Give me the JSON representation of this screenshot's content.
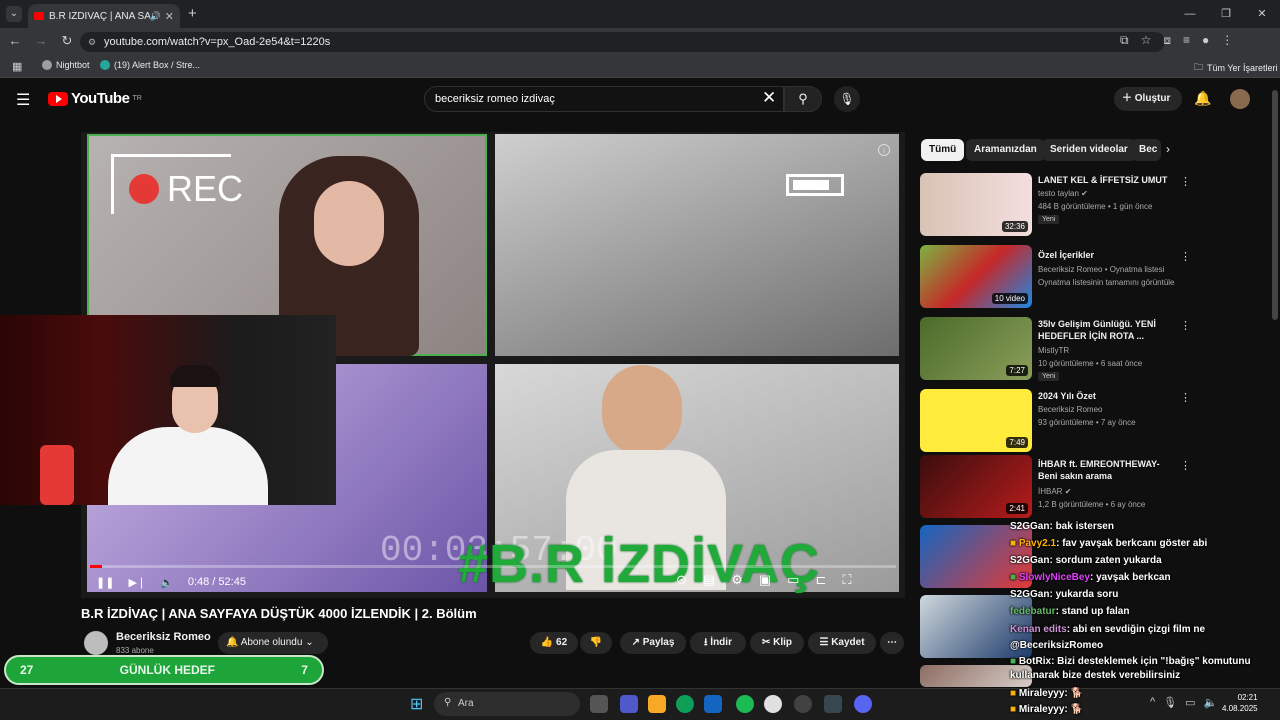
{
  "browser": {
    "tab_title": "B.R İZDİVAÇ | ANA SAYFAYA",
    "url": "youtube.com/watch?v=px_Oad-2e54&t=1220s",
    "bookmarks": [
      "Nightbot",
      "(19) Alert Box / Stre...",
      "Tüm Yer İşaretleri"
    ]
  },
  "masthead": {
    "logo_text": "YouTube",
    "region": "TR",
    "search_query": "beceriksiz romeo izdivaç",
    "create_label": "Oluştur"
  },
  "player": {
    "rec_label": "REC",
    "overlay_timer": "00:03:57:00",
    "overlay_title": "#B.R İZDİVAÇ",
    "time": "0:48 / 52:45",
    "progress": 0.015
  },
  "video": {
    "title": "B.R İZDİVAÇ | ANA SAYFAYA DÜŞTÜK 4000 İZLENDİK | 2. Bölüm",
    "channel": "Beceriksiz Romeo",
    "subscribers": "833 abone",
    "subscribe_label": "Abone olundu",
    "likes": "62",
    "share_label": "Paylaş",
    "download_label": "İndir",
    "clip_label": "Klip",
    "save_label": "Kaydet"
  },
  "chips": [
    "Tümü",
    "Aramanızdan",
    "Seriden videolar",
    "Bec"
  ],
  "recommendations": [
    {
      "title": "LANET KEL & İFFETSİZ UMUT",
      "channel": "testo taylan",
      "meta": "484 B görüntüleme • 1 gün önce",
      "badge": "Yeni",
      "duration": "32:36"
    },
    {
      "title": "Özel İçerikler",
      "channel": "Beceriksiz Romeo • Oynatma listesi",
      "meta": "Oynatma listesinin tamamını görüntüle",
      "badge": "",
      "duration": "10 video"
    },
    {
      "title": "35lv Gelişim Günlüğü. YENİ HEDEFLER İÇİN ROTA ...",
      "channel": "MistlyTR",
      "meta": "10 görüntüleme • 6 saat önce",
      "badge": "Yeni",
      "duration": "7:27"
    },
    {
      "title": "2024 Yılı Özet",
      "channel": "Beceriksiz Romeo",
      "meta": "93 görüntüleme • 7 ay önce",
      "badge": "",
      "duration": "7:49"
    },
    {
      "title": "İHBAR ft. EMREONTHEWAY- Beni sakın arama",
      "channel": "İHBAR",
      "meta": "1,2 B görüntüleme • 6 ay önce",
      "badge": "",
      "duration": "2:41"
    }
  ],
  "chat": [
    {
      "user": "S2GGan",
      "text": ": bak istersen"
    },
    {
      "user": "Pavy2.1",
      "text": ": fav yavşak berkcanı göster abi"
    },
    {
      "user": "S2GGan",
      "text": ": sordum zaten yukarda"
    },
    {
      "user": "SlowlyNiceBey",
      "text": ": yavşak berkcan"
    },
    {
      "user": "S2GGan",
      "text": ": yukarda soru"
    },
    {
      "user": "fedebatur",
      "text": ": stand up falan"
    },
    {
      "user": "Kenan edits",
      "text": ": abi en sevdiğin çizgi film ne"
    },
    {
      "user": "",
      "text": "@BeceriksizRomeo"
    },
    {
      "user": "BotRix",
      "text": ": Bizi desteklemek için \"!bağış\" komutunu"
    },
    {
      "user": "",
      "text": "kullanarak bize destek verebilirsiniz"
    },
    {
      "user": "Miraleyyy",
      "text": ": 🐕"
    },
    {
      "user": "Miraleyyy",
      "text": ": 🐕"
    }
  ],
  "goal": {
    "left": "27",
    "label": "GÜNLÜK HEDEF",
    "right": "7"
  },
  "taskbar": {
    "search_placeholder": "Ara",
    "time": "02:21",
    "date": "4.08.2025"
  },
  "colors": {
    "youtube_red": "#ff0000",
    "goal_green": "#1ea53a",
    "overlay_green": "#1faa3a"
  }
}
